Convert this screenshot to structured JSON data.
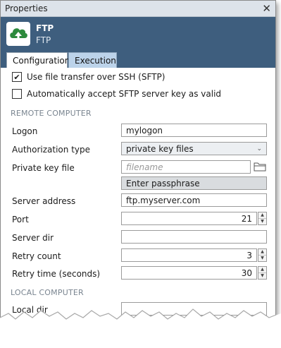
{
  "window": {
    "title": "Properties",
    "close_glyph": "✕"
  },
  "header": {
    "name": "FTP",
    "subtitle": "FTP",
    "icon": "cloud-upload-icon",
    "accent": "#3e5e7e"
  },
  "tabs": [
    {
      "label": "Configuration"
    },
    {
      "label": "Execution"
    }
  ],
  "options": [
    {
      "label": "Use file transfer over SSH (SFTP)",
      "checked": true
    },
    {
      "label": "Automatically accept SFTP server key as valid",
      "checked": false
    }
  ],
  "sections": {
    "remote": "REMOTE COMPUTER",
    "local": "LOCAL COMPUTER"
  },
  "fields": {
    "logon": {
      "label": "Logon",
      "value": "mylogon"
    },
    "auth": {
      "label": "Authorization type",
      "value": "private key files"
    },
    "key": {
      "label": "Private key file",
      "placeholder": "filename",
      "button": "Enter passphrase"
    },
    "server": {
      "label": "Server address",
      "value": "ftp.myserver.com"
    },
    "port": {
      "label": "Port",
      "value": "21"
    },
    "dir": {
      "label": "Server dir",
      "value": ""
    },
    "retry": {
      "label": "Retry count",
      "value": "3"
    },
    "retry_time": {
      "label": "Retry time (seconds)",
      "value": "30"
    },
    "local_dir": {
      "label": "Local dir",
      "value": ""
    }
  }
}
